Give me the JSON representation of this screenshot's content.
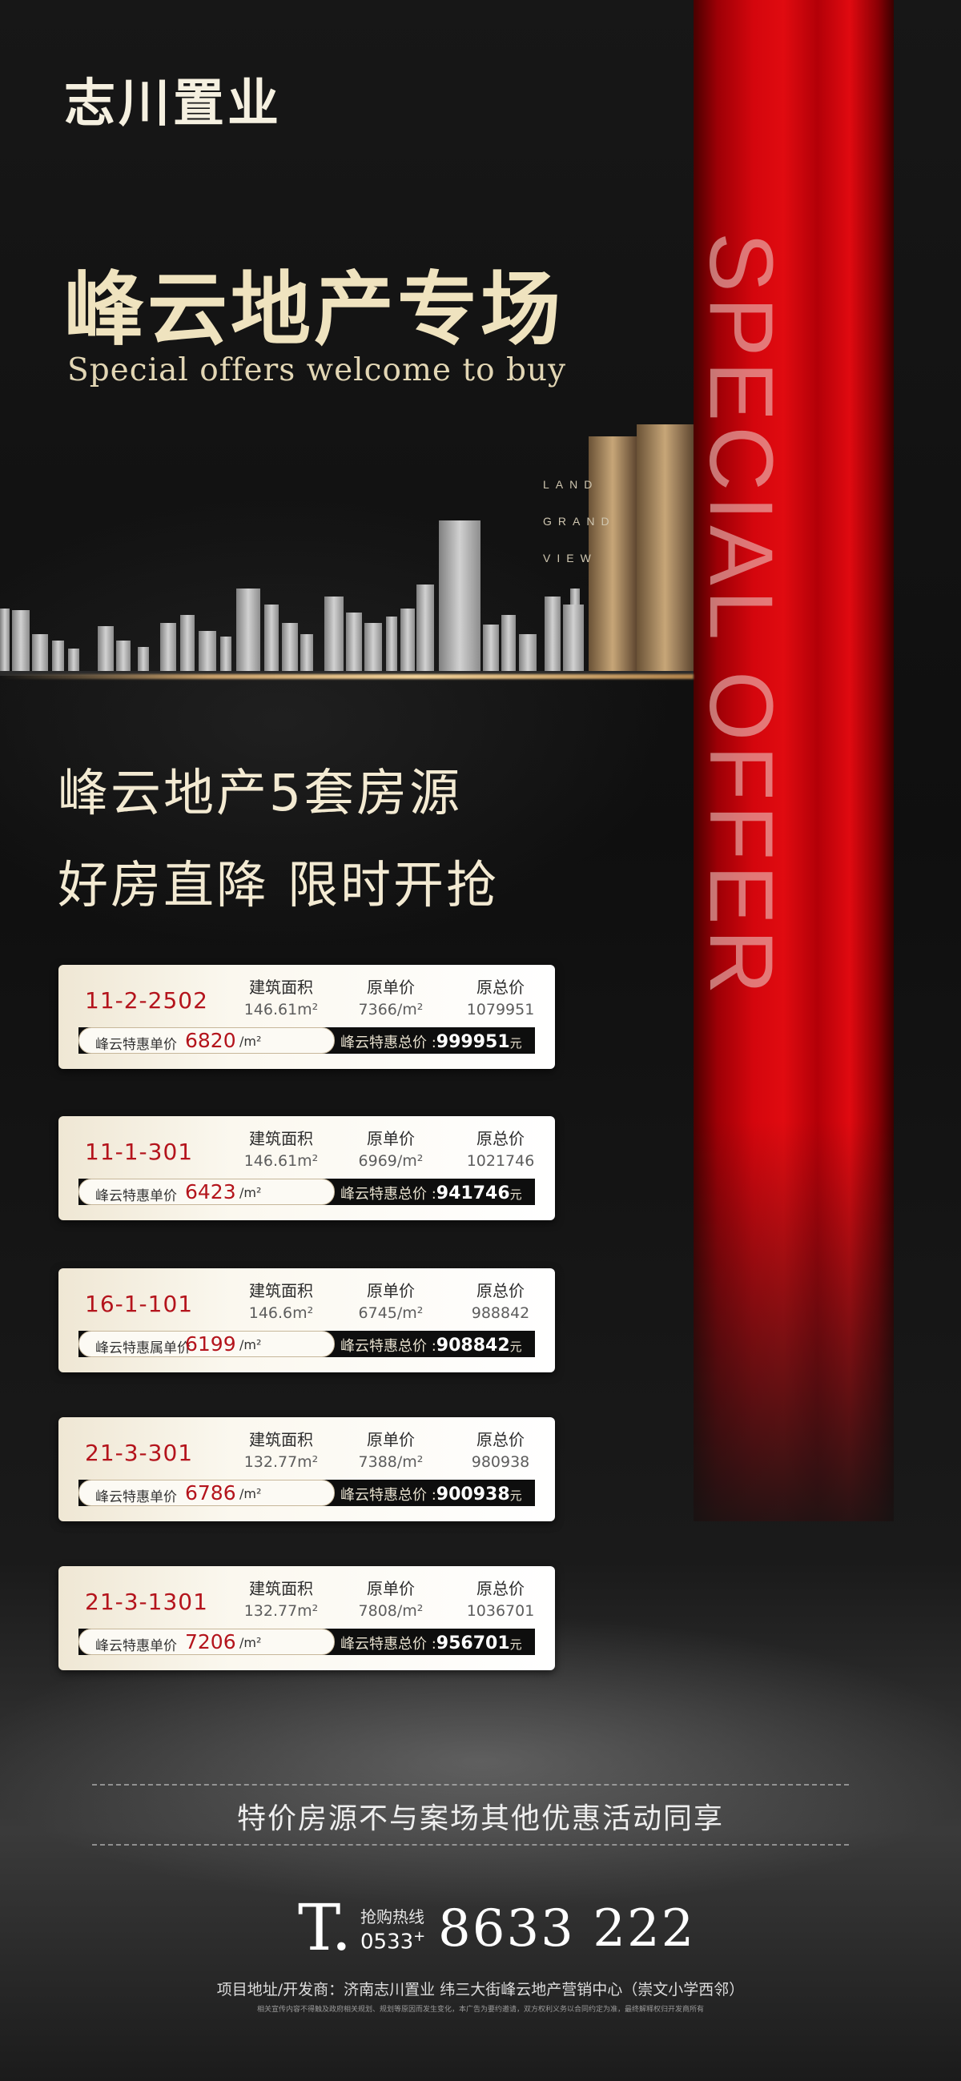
{
  "brand": {
    "logo": "志川置业"
  },
  "hero": {
    "title": "峰云地产专场",
    "subtitle": "Special offers welcome to buy",
    "curtain_text": "SPECIAL OFFER",
    "landmark_lines": [
      "LAND",
      "GRAND",
      "VIEW"
    ]
  },
  "headline": {
    "line1": "峰云地产5套房源",
    "line2": "好房直降  限时开抢"
  },
  "labels": {
    "area": "建筑面积",
    "unit_price": "原单价",
    "total_price": "原总价",
    "special_unit": "峰云特惠单价",
    "special_total": "峰云特惠总价 :",
    "per_m2": "/m²",
    "yuan": "元"
  },
  "listings": [
    {
      "code": "11-2-2502",
      "area": "146.61m²",
      "unit_price": "7366/m²",
      "total": "1079951",
      "special_label": "峰云特惠单价",
      "special_unit": "6820",
      "special_total": "999951"
    },
    {
      "code": "11-1-301",
      "area": "146.61m²",
      "unit_price": "6969/m²",
      "total": "1021746",
      "special_label": "峰云特惠单价",
      "special_unit": "6423",
      "special_total": "941746"
    },
    {
      "code": "16-1-101",
      "area": "146.6m²",
      "unit_price": "6745/m²",
      "total": "988842",
      "special_label": "峰云特惠属单价",
      "special_unit": "6199",
      "special_total": "908842"
    },
    {
      "code": "21-3-301",
      "area": "132.77m²",
      "unit_price": "7388/m²",
      "total": "980938",
      "special_label": "峰云特惠单价",
      "special_unit": "6786",
      "special_total": "900938"
    },
    {
      "code": "21-3-1301",
      "area": "132.77m²",
      "unit_price": "7808/m²",
      "total": "1036701",
      "special_label": "峰云特惠单价",
      "special_unit": "7206",
      "special_total": "956701"
    }
  ],
  "disclaimer": "特价房源不与案场其他优惠活动同享",
  "contact": {
    "t_letter": "T.",
    "hotline_label": "抢购热线",
    "area_code": "0533",
    "area_plus": "+",
    "number": "8633 222",
    "address": "项目地址/开发商：济南志川置业  纬三大街峰云地产营销中心（崇文小学西邻）",
    "fineprint": "相关宣传内容不得触及政府相关规划、规划等原因而发生变化，本广告为要约邀请，双方权利义务以合同约定为准，最终解释权归开发商所有"
  },
  "colors": {
    "accent_red": "#b4141c",
    "curtain_red": "#d4060d",
    "cream": "#efe3bf"
  }
}
